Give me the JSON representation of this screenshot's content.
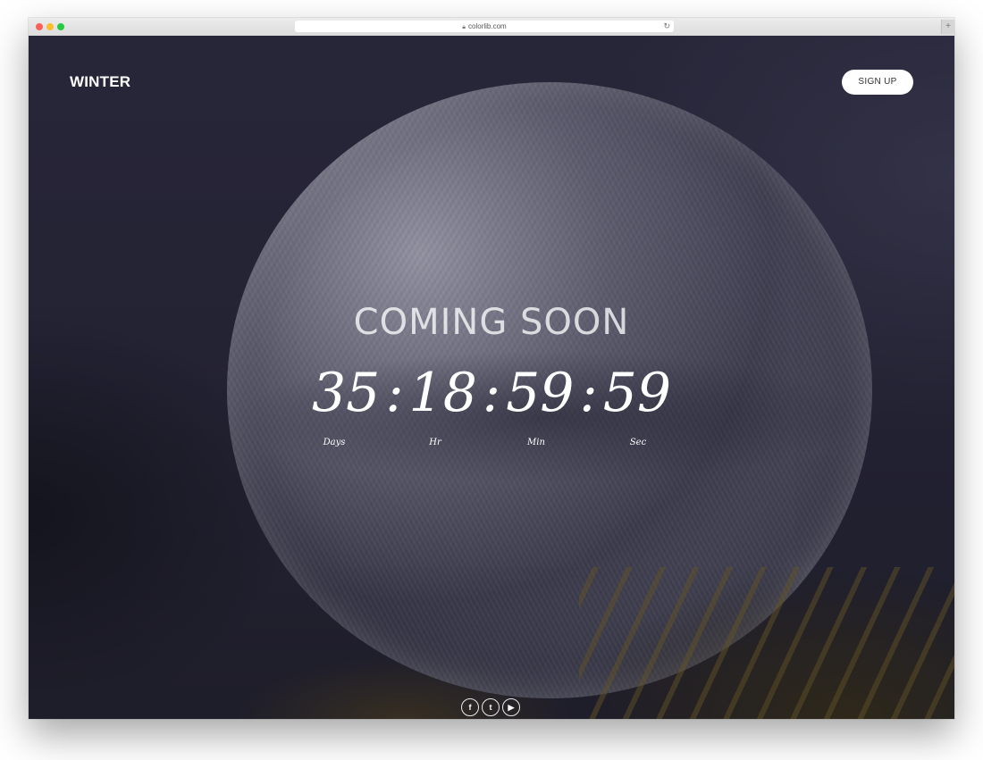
{
  "browser": {
    "url": "colorlib.com",
    "reload_icon": "reload-icon",
    "lock_icon": "lock-icon"
  },
  "header": {
    "logo": "WINTER",
    "signup_label": "SIGN UP"
  },
  "hero": {
    "title": "COMING SOON",
    "countdown": {
      "days": "35",
      "hours": "18",
      "minutes": "59",
      "seconds": "59",
      "separator": ":",
      "labels": {
        "days": "Days",
        "hours": "Hr",
        "minutes": "Min",
        "seconds": "Sec"
      }
    }
  },
  "social": {
    "facebook": "f",
    "twitter": "t",
    "youtube": "▶"
  }
}
